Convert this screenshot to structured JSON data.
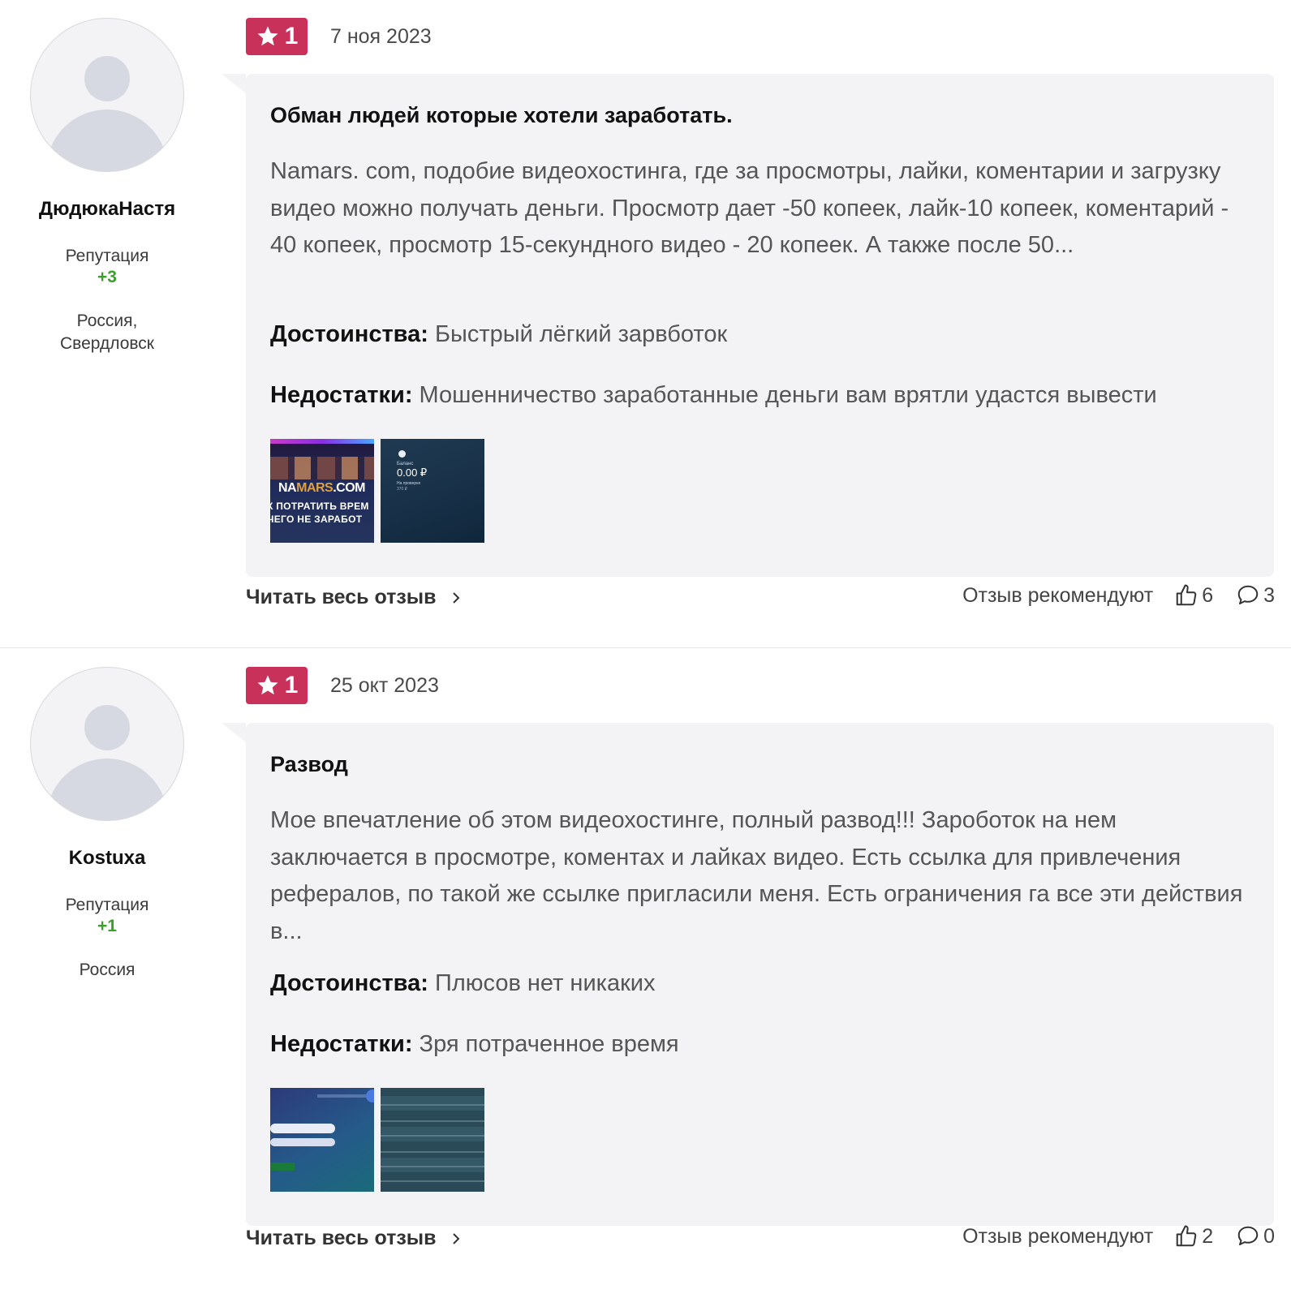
{
  "reviews": [
    {
      "user": {
        "name": "ДюдюкаНастя",
        "reputation_label": "Репутация",
        "reputation_value": "+3",
        "location_line1": "Россия,",
        "location_line2": "Свердловск"
      },
      "rating": "1",
      "date": "7 ноя 2023",
      "title": "Обман людей которые хотели заработать.",
      "text": "Namars. com, подобие видеохостинга, где за просмотры, лайки, коментарии и загрузку видео можно получать деньги. Просмотр дает -50 копеек, лайк-10 копеек, коментарий - 40 копеек, просмотр 15-секундного видео - 20 копеек. А также после 50...",
      "pros_label": "Достоинства:",
      "pros": "Быстрый лёгкий зарвботок",
      "cons_label": "Недостатки:",
      "cons": "Мошенничество заработанные деньги вам врятли удастся вывести",
      "thumbs": [
        {
          "logo_a": "NA",
          "logo_b": "MARS",
          "logo_c": ".COM",
          "cap1": "К ПОТРАТИТЬ ВРЕМ",
          "cap2": "ЧЕГО НЕ ЗАРАБОТ"
        },
        {
          "label": "Баланс",
          "amount": "0.00 ₽",
          "sub": "На проверке",
          "sub2": "370 ₽"
        }
      ],
      "read_more": "Читать весь отзыв",
      "recommend_label": "Отзыв рекомендуют",
      "likes": "6",
      "comments": "3"
    },
    {
      "user": {
        "name": "Kostuxa",
        "reputation_label": "Репутация",
        "reputation_value": "+1",
        "location_line1": "Россия",
        "location_line2": ""
      },
      "rating": "1",
      "date": "25 окт 2023",
      "title": "Развод",
      "text": "Мое впечатление об этом видеохостинге, полный развод!!! Зароботок на нем заключается в просмотре, коментах и лайках видео. Есть ссылка для привлечения рефералов, по такой же ссылке пригласили меня. Есть ограничения га все эти действия в...",
      "pros_label": "Достоинства:",
      "pros": "Плюсов нет никаких",
      "cons_label": "Недостатки:",
      "cons": "Зря потраченное время",
      "read_more": "Читать весь отзыв",
      "recommend_label": "Отзыв рекомендуют",
      "likes": "2",
      "comments": "0"
    }
  ],
  "colors": {
    "badge": "#c8325a",
    "reputation": "#3aa02a",
    "card_bg": "#f3f3f6"
  }
}
